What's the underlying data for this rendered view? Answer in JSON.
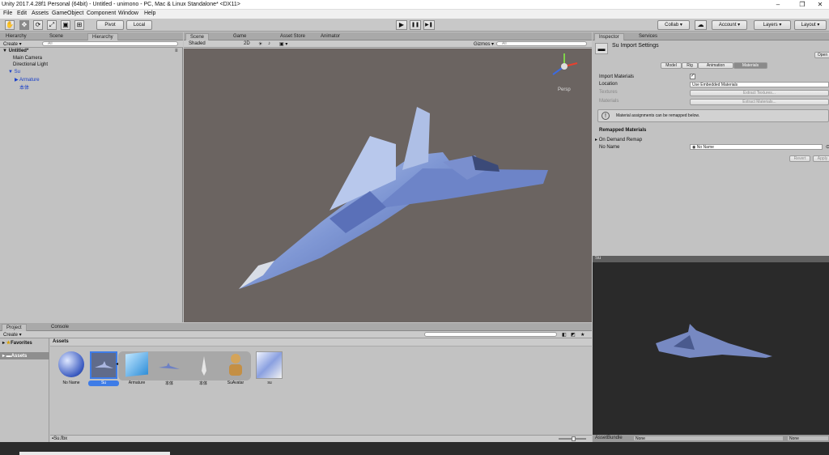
{
  "window": {
    "title": "Unity 2017.4.28f1 Personal (64bit) - Untitled - unimono - PC, Mac & Linux Standalone* <DX11>",
    "minimize": "‒",
    "maximize": "❐",
    "close": "✕"
  },
  "menu": [
    "File",
    "Edit",
    "Assets",
    "GameObject",
    "Component",
    "Window",
    "Help"
  ],
  "toolbar": {
    "pivot": "Pivot",
    "local": "Local",
    "collab": "Collab ▾",
    "account": "Account ▾",
    "layers": "Layers ▾",
    "layout": "Layout ▾",
    "tools": {
      "hand": "✋",
      "move": "✥",
      "rotate": "⟳",
      "scale": "⤢",
      "rect": "▣",
      "transform": "⊞"
    },
    "play": "▶",
    "pause": "❚❚",
    "step": "▶❚"
  },
  "hierarchy": {
    "tabs": [
      "Hierarchy",
      "Scene",
      "Hierarchy"
    ],
    "create": "Create ▾",
    "search": "All",
    "scene": "Untitled*",
    "items": [
      "Main Camera",
      "Directional Light"
    ],
    "root": "Su",
    "child": "Armature",
    "grandchild": "本体"
  },
  "scene": {
    "tabs": [
      "Scene",
      "Game",
      "Asset Store",
      "Animator"
    ],
    "shading": "Shaded",
    "mode2d": "2D",
    "gizmos": "Gizmos ▾",
    "search": "All",
    "persp": "Persp"
  },
  "inspector": {
    "tabs": [
      "Inspector",
      "Services"
    ],
    "title": "Su Import Settings",
    "open": "Open",
    "subtabs": [
      "Model",
      "Rig",
      "Animation",
      "Materials"
    ],
    "import_materials_label": "Import Materials",
    "location_label": "Location",
    "location_value": "Use Embedded Materials",
    "textures_label": "Textures",
    "extract_textures": "Extract Textures...",
    "materials_label": "Materials",
    "extract_materials": "Extract Materials...",
    "info": "Material assignments can be remapped below.",
    "remapped_header": "Remapped Materials",
    "on_demand": "On Demand Remap",
    "no_name_label": "No Name",
    "no_name_value": "No Name",
    "revert": "Revert",
    "apply": "Apply"
  },
  "preview": {
    "title": "Su",
    "assetbundle_label": "AssetBundle",
    "assetbundle_value": "None",
    "variant_value": "None"
  },
  "project": {
    "tabs": [
      "Project",
      "Console"
    ],
    "create": "Create ▾",
    "favorites": "Favorites",
    "assets_folder": "Assets",
    "breadcrumb": "Assets",
    "items": [
      "No Name",
      "Su",
      "Armature",
      "本体",
      "本体",
      "SuAvatar",
      "su"
    ],
    "selected_path": "Su.fbx"
  },
  "colors": {
    "selection": "#3e7ce7",
    "hierarchy_blue": "#1a40c8",
    "scene_bg": "#6b6461"
  }
}
